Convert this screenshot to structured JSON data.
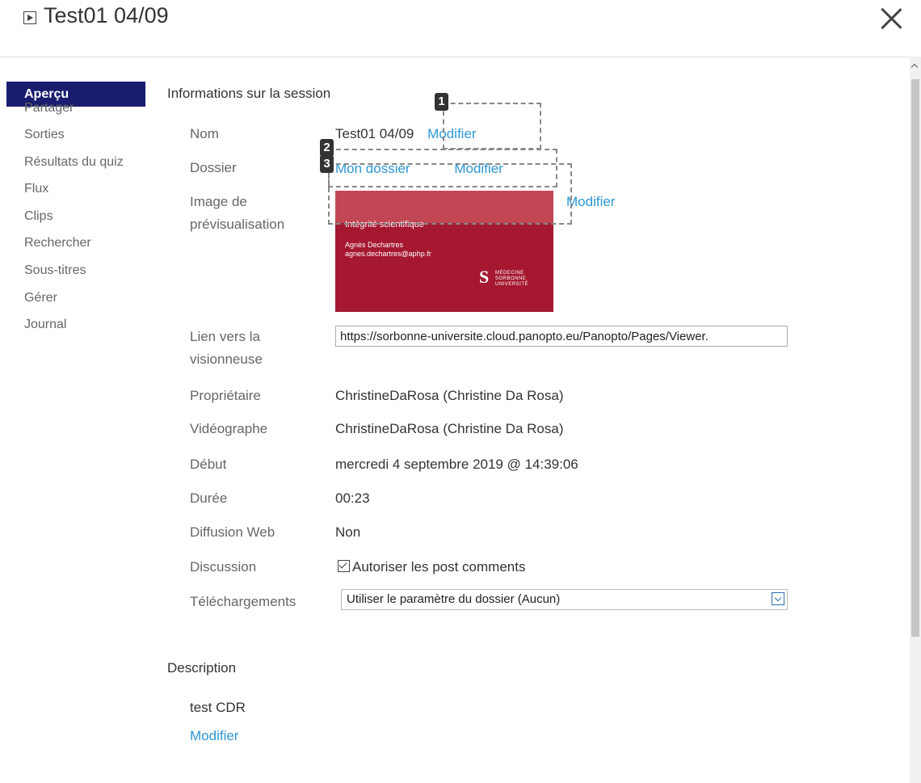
{
  "header": {
    "title": "Test01 04/09"
  },
  "sidebar": {
    "items": [
      {
        "label": "Aperçu"
      },
      {
        "label": "Partager"
      },
      {
        "label": "Sorties"
      },
      {
        "label": "Résultats du quiz"
      },
      {
        "label": "Flux"
      },
      {
        "label": "Clips"
      },
      {
        "label": "Rechercher"
      },
      {
        "label": "Sous-titres"
      },
      {
        "label": "Gérer"
      },
      {
        "label": "Journal"
      }
    ]
  },
  "info": {
    "section_title": "Informations sur la session",
    "edit_label": "Modifier",
    "name_label": "Nom",
    "name_value": "Test01 04/09",
    "folder_label": "Dossier",
    "folder_value": "Mon dossier",
    "preview_label_1": "Image de",
    "preview_label_2": "prévisualisation",
    "thumb_title": "Intégrité scientifique",
    "thumb_name": "Agnès Dechartres",
    "thumb_email": "agnes.dechartres@aphp.fr",
    "thumb_logo_1": "MÉDECINE",
    "thumb_logo_2": "SORBONNE",
    "thumb_logo_3": "UNIVERSITÉ",
    "viewer_label_1": "Lien vers la",
    "viewer_label_2": "visionneuse",
    "viewer_url": "https://sorbonne-universite.cloud.panopto.eu/Panopto/Pages/Viewer.",
    "owner_label": "Propriétaire",
    "owner_value": "ChristineDaRosa (Christine Da Rosa)",
    "videographer_label": "Vidéographe",
    "videographer_value": "ChristineDaRosa (Christine Da Rosa)",
    "start_label": "Début",
    "start_value": "mercredi 4 septembre 2019 @ 14:39:06",
    "duration_label": "Durée",
    "duration_value": "00:23",
    "webcast_label": "Diffusion Web",
    "webcast_value": "Non",
    "discussion_label": "Discussion",
    "discussion_value": "Autoriser les post comments",
    "downloads_label": "Téléchargements",
    "downloads_value": "Utiliser le paramètre du dossier (Aucun)"
  },
  "description": {
    "section_title": "Description",
    "text": "test CDR",
    "edit_label": "Modifier"
  },
  "annotations": [
    "1",
    "2",
    "3"
  ]
}
